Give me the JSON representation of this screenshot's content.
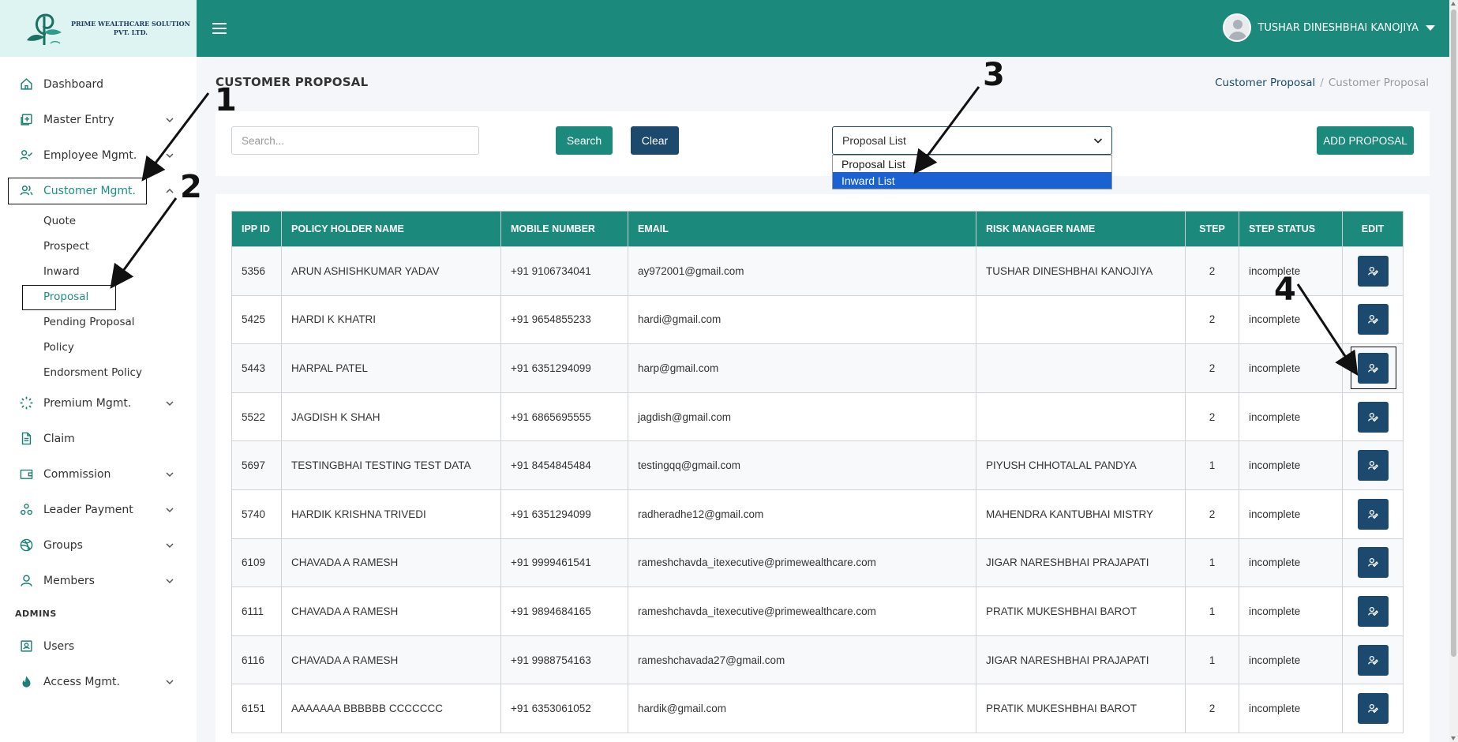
{
  "brand": {
    "line1": "PRIME WEALTHCARE SOLUTION",
    "line2": "PVT. LTD.",
    "colors": {
      "primary": "#1b8a7c",
      "dark": "#1c4a6e",
      "logo_bg": "#ddf4f2",
      "selected_option": "#1a62d2"
    }
  },
  "header": {
    "menu_icon": "hamburger-icon",
    "user_name": "TUSHAR DINESHBHAI KANOJIYA"
  },
  "sidebar": {
    "items": [
      {
        "label": "Dashboard",
        "icon": "home-icon"
      },
      {
        "label": "Master Entry",
        "icon": "plus-square-icon"
      },
      {
        "label": "Employee Mgmt.",
        "icon": "user-check-icon"
      },
      {
        "label": "Customer Mgmt.",
        "icon": "users-icon"
      }
    ],
    "customer_sub": [
      "Quote",
      "Prospect",
      "Inward",
      "Proposal",
      "Pending Proposal",
      "Policy",
      "Endorsment Policy"
    ],
    "items_after": [
      {
        "label": "Premium Mgmt.",
        "icon": "loader-icon"
      },
      {
        "label": "Claim",
        "icon": "file-text-icon"
      },
      {
        "label": "Commission",
        "icon": "wallet-icon"
      },
      {
        "label": "Leader Payment",
        "icon": "connections-icon"
      },
      {
        "label": "Groups",
        "icon": "dribbble-icon"
      },
      {
        "label": "Members",
        "icon": "user-icon"
      }
    ],
    "section_admins": "ADMINS",
    "admin_items": [
      {
        "label": "Users",
        "icon": "user-square-icon"
      },
      {
        "label": "Access Mgmt.",
        "icon": "flame-icon"
      }
    ]
  },
  "page": {
    "title": "CUSTOMER PROPOSAL",
    "breadcrumb": {
      "link": "Customer Proposal",
      "separator": "/",
      "current": "Customer Proposal"
    }
  },
  "filters": {
    "search_placeholder": "Search...",
    "search_label": "Search",
    "clear_label": "Clear",
    "select_value": "Proposal List",
    "options": [
      "Proposal List",
      "Inward List"
    ],
    "highlighted_option": "Inward List",
    "add_label": "ADD PROPOSAL"
  },
  "table": {
    "headers": [
      "IPP ID",
      "POLICY HOLDER NAME",
      "MOBILE NUMBER",
      "EMAIL",
      "RISK MANAGER NAME",
      "STEP",
      "STEP STATUS",
      "EDIT"
    ],
    "rows": [
      [
        "5356",
        "ARUN ASHISHKUMAR YADAV",
        "+91 9106734041",
        "ay972001@gmail.com",
        "TUSHAR DINESHBHAI KANOJIYA",
        "2",
        "incomplete"
      ],
      [
        "5425",
        "HARDI K KHATRI",
        "+91 9654855233",
        "hardi@gmail.com",
        "",
        "2",
        "incomplete"
      ],
      [
        "5443",
        "HARPAL PATEL",
        "+91 6351294099",
        "harp@gmail.com",
        "",
        "2",
        "incomplete"
      ],
      [
        "5522",
        "JAGDISH K SHAH",
        "+91 6865695555",
        "jagdish@gmail.com",
        "",
        "2",
        "incomplete"
      ],
      [
        "5697",
        "TESTINGBHAI TESTING TEST DATA",
        "+91 8454845484",
        "testingqq@gmail.com",
        "PIYUSH CHHOTALAL PANDYA",
        "1",
        "incomplete"
      ],
      [
        "5740",
        "HARDIK KRISHNA TRIVEDI",
        "+91 6351294099",
        "radheradhe12@gmail.com",
        "MAHENDRA KANTUBHAI MISTRY",
        "2",
        "incomplete"
      ],
      [
        "6109",
        "CHAVADA A RAMESH",
        "+91 9999461541",
        "rameshchavda_itexecutive@primewealthcare.com",
        "JIGAR NARESHBHAI PRAJAPATI",
        "1",
        "incomplete"
      ],
      [
        "6111",
        "CHAVADA A RAMESH",
        "+91 9894684165",
        "rameshchavda_itexecutive@primewealthcare.com",
        "PRATIK MUKESHBHAI BAROT",
        "1",
        "incomplete"
      ],
      [
        "6116",
        "CHAVADA A RAMESH",
        "+91 9988754163",
        "rameshchavada27@gmail.com",
        "JIGAR NARESHBHAI PRAJAPATI",
        "1",
        "incomplete"
      ],
      [
        "6151",
        "AAAAAAA BBBBBB CCCCCCC",
        "+91 6353061052",
        "hardik@gmail.com",
        "PRATIK MUKESHBHAI BAROT",
        "2",
        "incomplete"
      ]
    ]
  },
  "annotations": {
    "labels": [
      "1",
      "2",
      "3",
      "4"
    ]
  }
}
